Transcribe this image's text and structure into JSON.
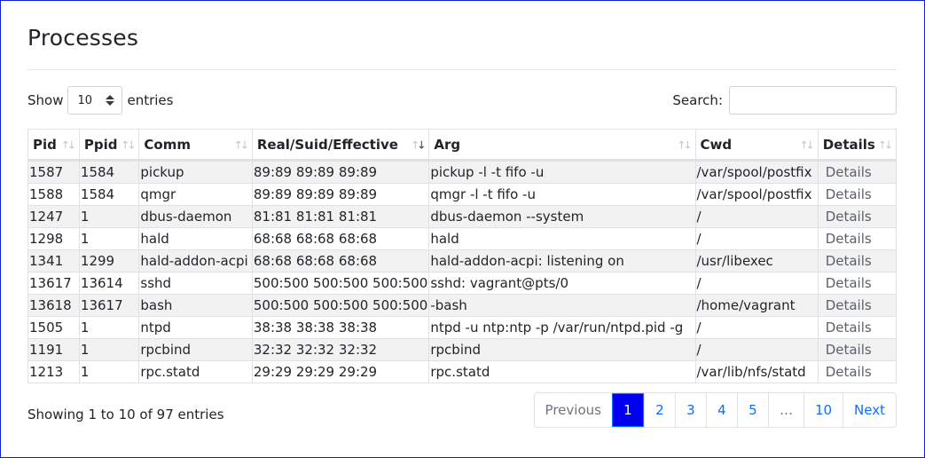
{
  "page": {
    "title": "Processes"
  },
  "length_menu": {
    "show_label": "Show",
    "value": "10",
    "entries_label": "entries"
  },
  "search": {
    "label": "Search:",
    "value": "",
    "placeholder": ""
  },
  "table": {
    "columns": [
      {
        "label": "Pid",
        "sort": "none"
      },
      {
        "label": "Ppid",
        "sort": "none"
      },
      {
        "label": "Comm",
        "sort": "none"
      },
      {
        "label": "Real/Suid/Effective",
        "sort": "descending"
      },
      {
        "label": "Arg",
        "sort": "none"
      },
      {
        "label": "Cwd",
        "sort": "none"
      },
      {
        "label": "Details",
        "sort": "none"
      }
    ],
    "rows": [
      {
        "pid": "1587",
        "ppid": "1584",
        "comm": "pickup",
        "ids": "89:89 89:89 89:89",
        "arg": "pickup -l -t fifo -u",
        "cwd": "/var/spool/postfix",
        "details": "Details"
      },
      {
        "pid": "1588",
        "ppid": "1584",
        "comm": "qmgr",
        "ids": "89:89 89:89 89:89",
        "arg": "qmgr -l -t fifo -u",
        "cwd": "/var/spool/postfix",
        "details": "Details"
      },
      {
        "pid": "1247",
        "ppid": "1",
        "comm": "dbus-daemon",
        "ids": "81:81 81:81 81:81",
        "arg": "dbus-daemon --system",
        "cwd": "/",
        "details": "Details"
      },
      {
        "pid": "1298",
        "ppid": "1",
        "comm": "hald",
        "ids": "68:68 68:68 68:68",
        "arg": "hald",
        "cwd": "/",
        "details": "Details"
      },
      {
        "pid": "1341",
        "ppid": "1299",
        "comm": "hald-addon-acpi",
        "ids": "68:68 68:68 68:68",
        "arg": "hald-addon-acpi: listening on",
        "cwd": "/usr/libexec",
        "details": "Details"
      },
      {
        "pid": "13617",
        "ppid": "13614",
        "comm": "sshd",
        "ids": "500:500 500:500 500:500",
        "arg": "sshd: vagrant@pts/0",
        "cwd": "/",
        "details": "Details"
      },
      {
        "pid": "13618",
        "ppid": "13617",
        "comm": "bash",
        "ids": "500:500 500:500 500:500",
        "arg": "-bash",
        "cwd": "/home/vagrant",
        "details": "Details"
      },
      {
        "pid": "1505",
        "ppid": "1",
        "comm": "ntpd",
        "ids": "38:38 38:38 38:38",
        "arg": "ntpd -u ntp:ntp -p /var/run/ntpd.pid -g",
        "cwd": "/",
        "details": "Details"
      },
      {
        "pid": "1191",
        "ppid": "1",
        "comm": "rpcbind",
        "ids": "32:32 32:32 32:32",
        "arg": "rpcbind",
        "cwd": "/",
        "details": "Details"
      },
      {
        "pid": "1213",
        "ppid": "1",
        "comm": "rpc.statd",
        "ids": "29:29 29:29 29:29",
        "arg": "rpc.statd",
        "cwd": "/var/lib/nfs/statd",
        "details": "Details"
      }
    ]
  },
  "info": {
    "text": "Showing 1 to 10 of 97 entries"
  },
  "pagination": {
    "previous": "Previous",
    "pages": [
      "1",
      "2",
      "3",
      "4",
      "5",
      "…",
      "10"
    ],
    "active_page": "1",
    "next": "Next"
  },
  "colors": {
    "active_page_bg": "#0000ee",
    "link": "#0d6efd",
    "window_border": "#0a1fd8"
  }
}
